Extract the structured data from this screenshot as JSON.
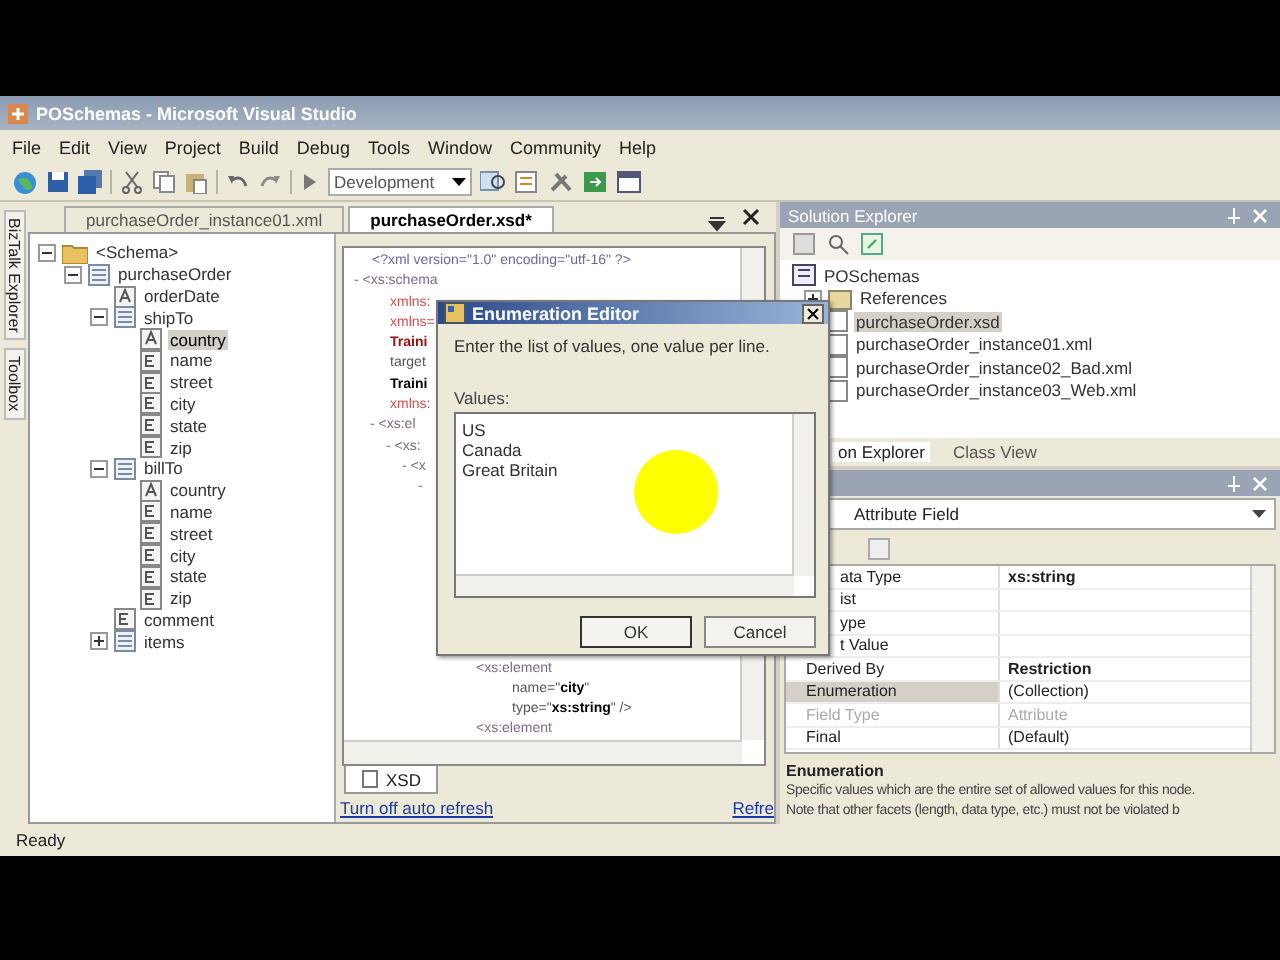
{
  "window": {
    "title": "POSchemas - Microsoft Visual Studio"
  },
  "menu": [
    "File",
    "Edit",
    "View",
    "Project",
    "Build",
    "Debug",
    "Tools",
    "Window",
    "Community",
    "Help"
  ],
  "toolbar": {
    "configuration": "Development"
  },
  "side_tabs": [
    "BizTalk Explorer",
    "Toolbox"
  ],
  "document_tabs": [
    {
      "label": "purchaseOrder_instance01.xml",
      "selected": false
    },
    {
      "label": "purchaseOrder.xsd*",
      "selected": true
    }
  ],
  "schema_tree": [
    {
      "label": "<Schema>",
      "kind": "folder",
      "expanded": true,
      "selected": false,
      "children": [
        {
          "label": "purchaseOrder",
          "kind": "record",
          "expanded": true,
          "selected": false,
          "children": [
            {
              "label": "orderDate",
              "kind": "attribute",
              "selected": false
            },
            {
              "label": "shipTo",
              "kind": "record",
              "expanded": true,
              "selected": false,
              "children": [
                {
                  "label": "country",
                  "kind": "attribute",
                  "selected": true
                },
                {
                  "label": "name",
                  "kind": "element",
                  "selected": false
                },
                {
                  "label": "street",
                  "kind": "element",
                  "selected": false
                },
                {
                  "label": "city",
                  "kind": "element",
                  "selected": false
                },
                {
                  "label": "state",
                  "kind": "element",
                  "selected": false
                },
                {
                  "label": "zip",
                  "kind": "element",
                  "selected": false
                }
              ]
            },
            {
              "label": "billTo",
              "kind": "record",
              "expanded": true,
              "selected": false,
              "children": [
                {
                  "label": "country",
                  "kind": "attribute",
                  "selected": false
                },
                {
                  "label": "name",
                  "kind": "element",
                  "selected": false
                },
                {
                  "label": "street",
                  "kind": "element",
                  "selected": false
                },
                {
                  "label": "city",
                  "kind": "element",
                  "selected": false
                },
                {
                  "label": "state",
                  "kind": "element",
                  "selected": false
                },
                {
                  "label": "zip",
                  "kind": "element",
                  "selected": false
                }
              ]
            },
            {
              "label": "comment",
              "kind": "element",
              "selected": false
            },
            {
              "label": "items",
              "kind": "record",
              "expanded": false,
              "selected": false
            }
          ]
        }
      ]
    }
  ],
  "xsd_view": {
    "upper": [
      {
        "text": "<?xml version=\"1.0\" encoding=\"utf-16\" ?>",
        "kind": "pi"
      },
      {
        "text": "- <xs:schema",
        "kind": "tag",
        "children": [
          {
            "text": "xmlns:",
            "kind": "attr"
          },
          {
            "text": "xmlns=",
            "kind": "attr"
          },
          {
            "text": "Traini",
            "kind": "value"
          },
          {
            "text": "target",
            "kind": "plain"
          },
          {
            "text": "Traini",
            "kind": "strong"
          },
          {
            "text": "xmlns:",
            "kind": "attr"
          },
          {
            "text": "- <xs:el",
            "kind": "tag",
            "children": [
              {
                "text": "- <xs:",
                "kind": "tag",
                "children": [
                  {
                    "text": "- <x",
                    "kind": "tag",
                    "children": [
                      {
                        "text": "-",
                        "kind": "tag"
                      }
                    ]
                  }
                ]
              }
            ]
          }
        ]
      }
    ],
    "lower": [
      {
        "text": "<xs:element",
        "kind": "tag",
        "children": [
          {
            "text": "name=\"**city**\"",
            "kind": "plain"
          },
          {
            "text": "type=\"**xs:string**\" />",
            "kind": "plain"
          }
        ]
      },
      {
        "text": "<xs:element",
        "kind": "tag"
      }
    ],
    "tabs": [
      {
        "label": "XSD",
        "selected": true
      }
    ],
    "links": [
      "Turn off auto refresh",
      "Refre"
    ]
  },
  "solution_explorer": {
    "title": "Solution Explorer",
    "tree": [
      {
        "label": "POSchemas",
        "kind": "project",
        "selected": false,
        "children": [
          {
            "label": "References",
            "kind": "references",
            "expanded": false,
            "selected": false
          },
          {
            "label": "purchaseOrder.xsd",
            "kind": "schema",
            "selected": true
          },
          {
            "label": "purchaseOrder_instance01.xml",
            "kind": "xml",
            "selected": false
          },
          {
            "label": "purchaseOrder_instance02_Bad.xml",
            "kind": "xml",
            "selected": false
          },
          {
            "label": "purchaseOrder_instance03_Web.xml",
            "kind": "xml",
            "selected": false
          }
        ]
      }
    ],
    "tabs": [
      {
        "label": "on Explorer",
        "selected": true
      },
      {
        "label": "Class View",
        "selected": false
      }
    ]
  },
  "properties": {
    "object": "Attribute Field",
    "rows": [
      {
        "name": "ata Type",
        "value": "xs:string",
        "modified": true,
        "selected": false,
        "disabled": false
      },
      {
        "name": "ist",
        "selected": false,
        "disabled": false
      },
      {
        "name": "ype",
        "selected": false,
        "disabled": false
      },
      {
        "name": "t Value",
        "selected": false,
        "disabled": false
      },
      {
        "name": "Derived By",
        "value": "Restriction",
        "modified": true,
        "selected": false,
        "disabled": false
      },
      {
        "name": "Enumeration",
        "value": "(Collection)",
        "modified": false,
        "selected": true,
        "disabled": false
      },
      {
        "name": "Field Type",
        "value": "Attribute",
        "modified": false,
        "selected": false,
        "disabled": true
      },
      {
        "name": "Final",
        "value": "(Default)",
        "modified": false,
        "selected": false,
        "disabled": false
      }
    ],
    "description": {
      "title": "Enumeration",
      "lines": [
        "Specific values which are the entire set of allowed values for this node.",
        "Note that other facets (length, data type, etc.) must not be violated b"
      ]
    }
  },
  "dialog": {
    "title": "Enumeration Editor",
    "prompt": "Enter the list of values, one value per line.",
    "values_label": "Values:",
    "values": [
      "US",
      "Canada",
      "Great Britain"
    ],
    "buttons": [
      "OK",
      "Cancel"
    ]
  },
  "status_bar": {
    "text": "Ready"
  }
}
